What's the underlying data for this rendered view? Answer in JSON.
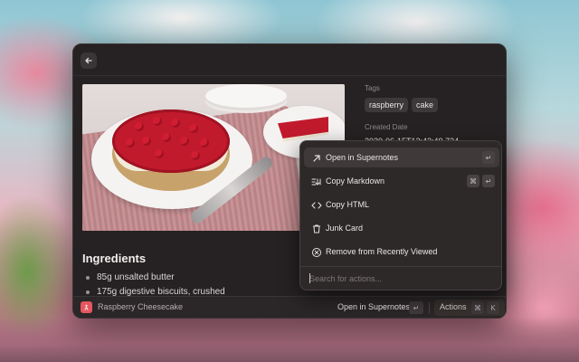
{
  "window": {
    "image_alt": "Raspberry Cheesecake photo"
  },
  "ingredients": {
    "title": "Ingredients",
    "items": [
      "85g unsalted butter",
      "175g digestive biscuits, crushed"
    ]
  },
  "meta": {
    "tags_label": "Tags",
    "tags": [
      "raspberry",
      "cake"
    ],
    "created_label": "Created Date",
    "created_value": "2020-06-15T12:42:49.734"
  },
  "footer": {
    "title": "Raspberry Cheesecake",
    "primary_action": "Open in Supernotes",
    "primary_shortcut": "↵",
    "actions_label": "Actions",
    "actions_shortcut_mod": "⌘",
    "actions_shortcut_key": "K"
  },
  "menu": {
    "items": [
      {
        "label": "Open in Supernotes",
        "icon": "arrow-up-right-icon",
        "shortcut": [
          "↵"
        ],
        "selected": true
      },
      {
        "label": "Copy Markdown",
        "icon": "markdown-icon",
        "shortcut": [
          "⌘",
          "↵"
        ],
        "selected": false
      },
      {
        "label": "Copy HTML",
        "icon": "code-icon",
        "shortcut": [],
        "selected": false
      },
      {
        "label": "Junk Card",
        "icon": "trash-icon",
        "shortcut": [],
        "selected": false
      },
      {
        "label": "Remove from Recently Viewed",
        "icon": "remove-circle-icon",
        "shortcut": [],
        "selected": false
      }
    ],
    "search_placeholder": "Search for actions..."
  },
  "colors": {
    "accent": "#e5575f",
    "window_bg": "#262223",
    "menu_bg": "#2e2929"
  }
}
